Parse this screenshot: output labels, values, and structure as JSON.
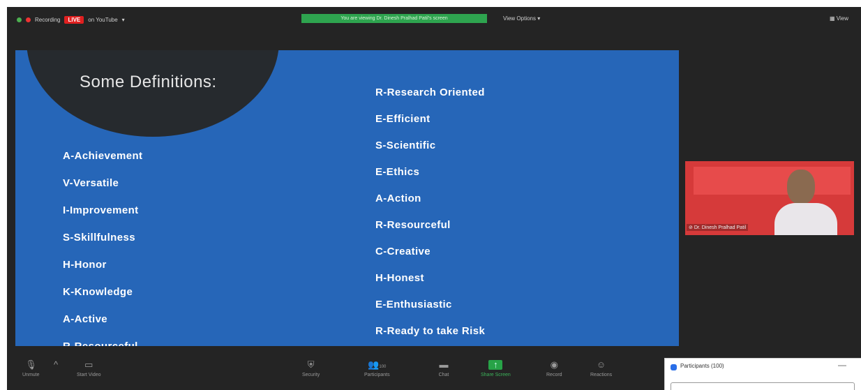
{
  "topbar": {
    "recording_label": "Recording",
    "live_badge": "LIVE",
    "platform_label": "on YouTube",
    "viewing_banner": "You are viewing Dr. Dinesh Pralhad Patil's screen",
    "view_options": "View Options",
    "view_label": "View"
  },
  "slide": {
    "title": "Some Definitions:",
    "left_items": [
      "A-Achievement",
      "V-Versatile",
      "I-Improvement",
      "S-Skillfulness",
      "H-Honor",
      "K-Knowledge",
      "A-Active",
      "R-Resourceful"
    ],
    "right_items": [
      "R-Research Oriented",
      "E-Efficient",
      "S-Scientific",
      "E-Ethics",
      "A-Action",
      "R-Resourceful",
      "C-Creative",
      "H-Honest",
      "E-Enthusiastic",
      "R-Ready to take Risk"
    ]
  },
  "video": {
    "name": "Dr. Dinesh Pralhad Patil"
  },
  "toolbar": {
    "unmute": "Unmute",
    "start_video": "Start Video",
    "security": "Security",
    "participants": "Participants",
    "participants_count": "100",
    "chat": "Chat",
    "share_screen": "Share Screen",
    "record": "Record",
    "reactions": "Reactions"
  },
  "panel": {
    "title": "Participants (100)"
  },
  "colors": {
    "slide_bg": "#2666b8",
    "app_bg": "#242424",
    "live_red": "#e02020",
    "banner_green": "#2ea44f"
  }
}
